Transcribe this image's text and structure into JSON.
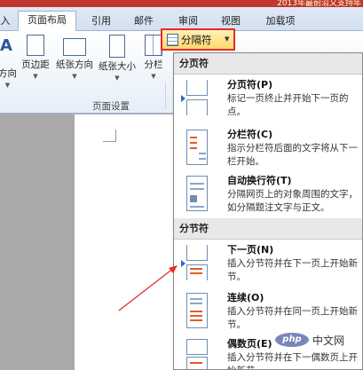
{
  "window": {
    "title": "2013年最前沿又支持年"
  },
  "tabs": [
    {
      "label": "入"
    },
    {
      "label": "页面布局"
    },
    {
      "label": "引用"
    },
    {
      "label": "邮件"
    },
    {
      "label": "审阅"
    },
    {
      "label": "视图"
    },
    {
      "label": "加载项"
    }
  ],
  "ribbon": {
    "text_direction_fragment": "方向",
    "margins": "页边距",
    "orientation": "纸张方向",
    "size": "纸张大小",
    "columns": "分栏",
    "breaks": "分隔符",
    "group_label": "页面设置",
    "big_letter": "A"
  },
  "menu": {
    "section_page": "分页符",
    "section_section": "分节符",
    "items": [
      {
        "title": "分页符(P)",
        "desc": "标记一页终止并开始下一页的点。"
      },
      {
        "title": "分栏符(C)",
        "desc": "指示分栏符后面的文字将从下一栏开始。"
      },
      {
        "title": "自动换行符(T)",
        "desc": "分隔网页上的对象周围的文字，如分隔题注文字与正文。"
      },
      {
        "title": "下一页(N)",
        "desc": "插入分节符并在下一页上开始新节。"
      },
      {
        "title": "连续(O)",
        "desc": "插入分节符并在同一页上开始新节。"
      },
      {
        "title": "偶数页(E)",
        "desc": "插入分节符并在下一偶数页上开始新节。"
      }
    ]
  },
  "watermark": {
    "badge": "php",
    "site": "中文网"
  },
  "colors": {
    "highlight_border": "#e8292d",
    "arrow": "#e8292d",
    "accent_orange": "#e55b27"
  }
}
